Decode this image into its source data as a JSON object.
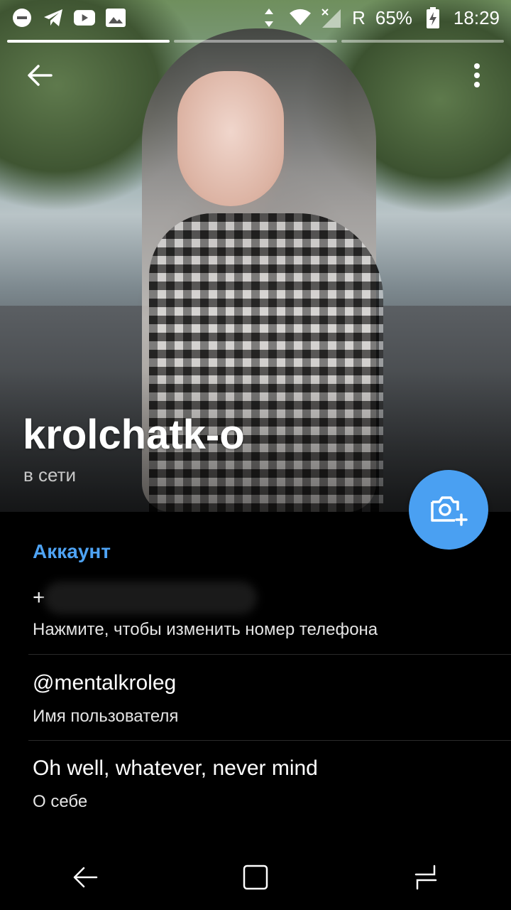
{
  "status_bar": {
    "left_icons": [
      "do-not-disturb-icon",
      "telegram-icon",
      "youtube-icon",
      "gallery-icon"
    ],
    "right_icons": [
      "data-arrows-icon",
      "wifi-icon",
      "no-signal-icon"
    ],
    "roaming": "R",
    "battery_percent": "65%",
    "time": "18:29"
  },
  "story": {
    "segments": 3,
    "active_index": 0
  },
  "toolbar": {
    "back_icon": "arrow-back-icon",
    "more_icon": "more-vert-icon"
  },
  "profile": {
    "name": "krolchatk-o",
    "status": "в сети"
  },
  "fab": {
    "icon": "camera-add-icon",
    "color": "#4aa0f2"
  },
  "account": {
    "title": "Аккаунт",
    "title_color": "#4ea3f4",
    "phone": {
      "value": "+",
      "hint": "Нажмите, чтобы изменить номер телефона"
    },
    "username": {
      "value": "@mentalkroleg",
      "label": "Имя пользователя"
    },
    "bio": {
      "value": "Oh well, whatever, never mind",
      "label": "О себе"
    }
  },
  "nav": {
    "back_icon": "nav-back-icon",
    "home_icon": "nav-home-icon",
    "recents_icon": "nav-recents-icon"
  }
}
